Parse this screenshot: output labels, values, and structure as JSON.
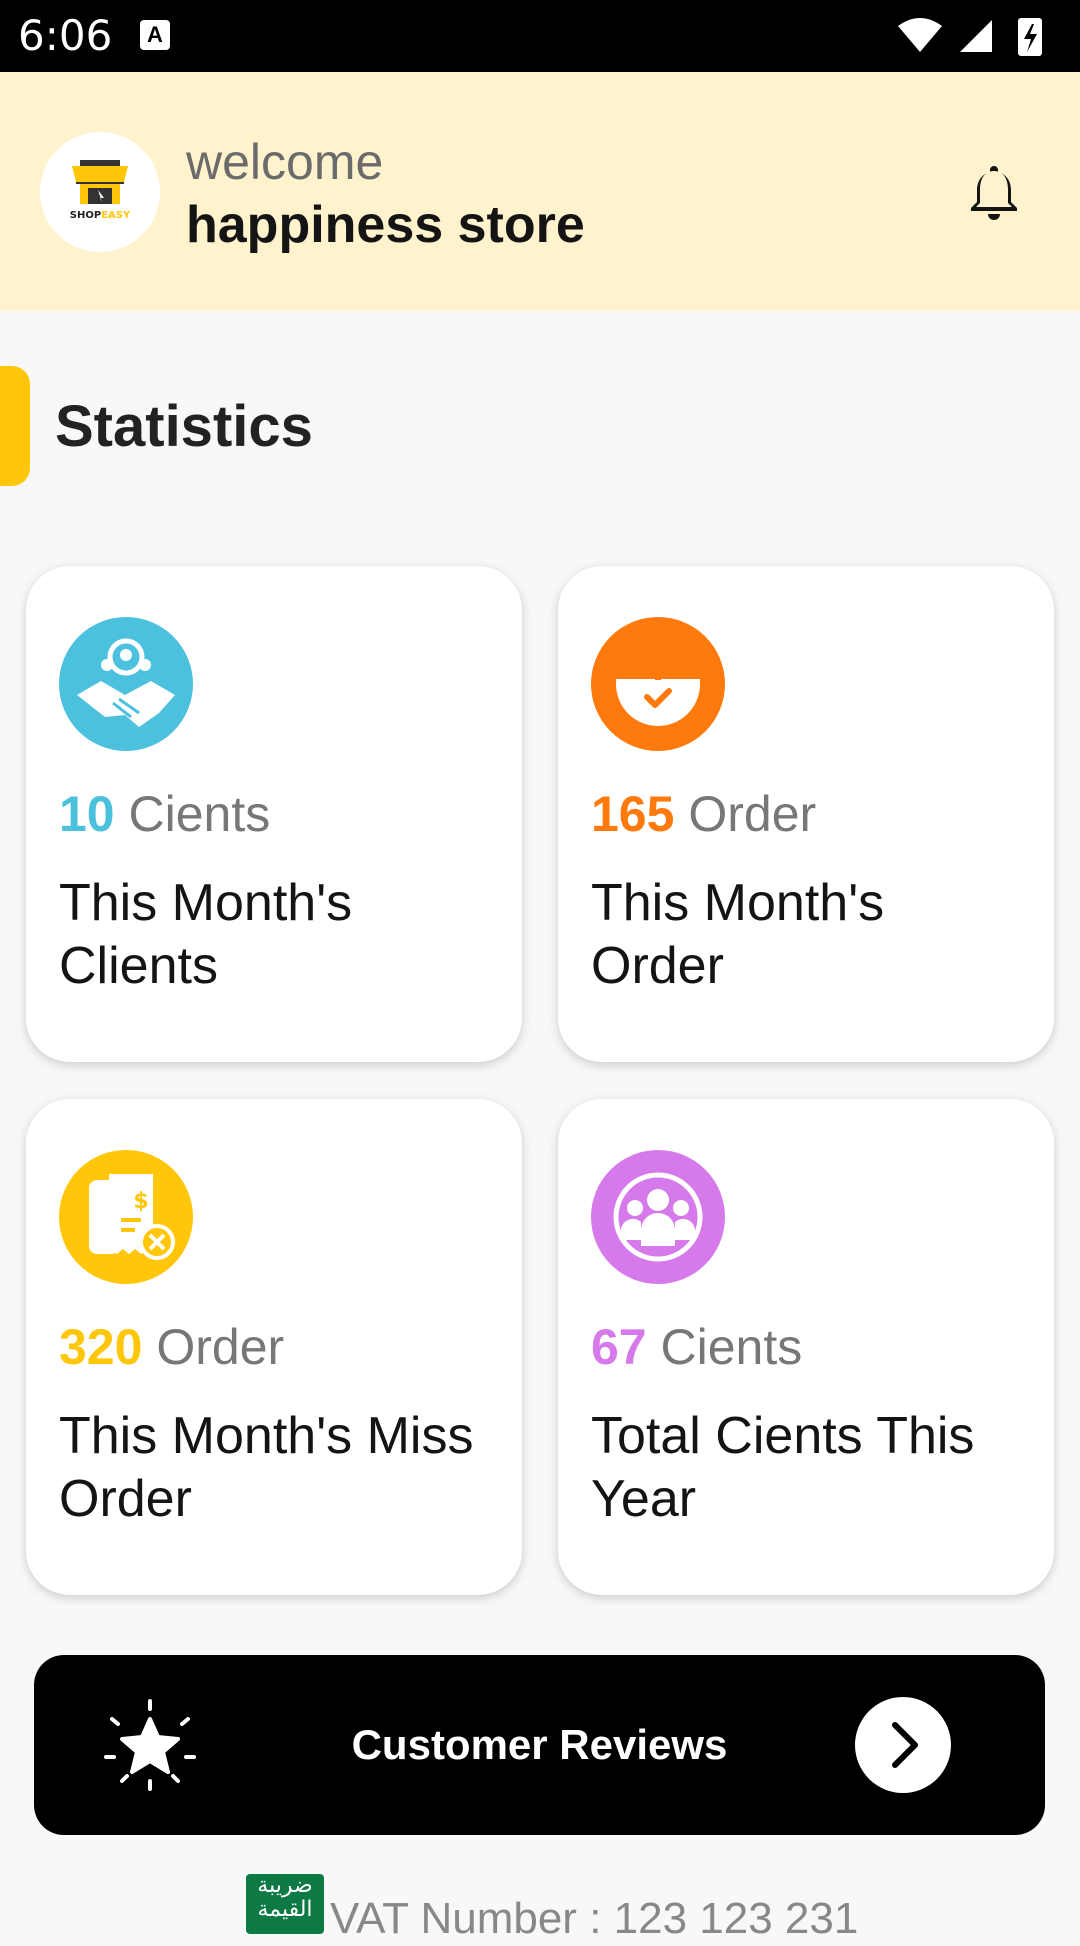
{
  "status_bar": {
    "time": "6:06",
    "badge": "A"
  },
  "header": {
    "welcome": "welcome",
    "store_name": "happiness store",
    "logo_text": "SHOPEASY"
  },
  "section": {
    "title": "Statistics"
  },
  "cards": [
    {
      "value": "10",
      "unit": "Cients",
      "label": "This Month's Clients",
      "color": "#4bc1dd",
      "icon": "clients-handshake-icon"
    },
    {
      "value": "165",
      "unit": "Order",
      "label": "This Month's Order",
      "color": "#ff7a0d",
      "icon": "order-timer-icon"
    },
    {
      "value": "320",
      "unit": "Order",
      "label": "This Month's Miss Order",
      "color": "#ffc60a",
      "icon": "miss-order-receipt-icon"
    },
    {
      "value": "67",
      "unit": "Cients",
      "label": "Total Cients This Year",
      "color": "#d67aeb",
      "icon": "group-users-icon"
    }
  ],
  "reviews": {
    "label": "Customer Reviews"
  },
  "vat": {
    "badge": "ضريبة القيمة",
    "text": "VAT Number : 123 123 231"
  },
  "colors": {
    "accent": "#ffc60a",
    "header_bg": "#fff3cd"
  }
}
